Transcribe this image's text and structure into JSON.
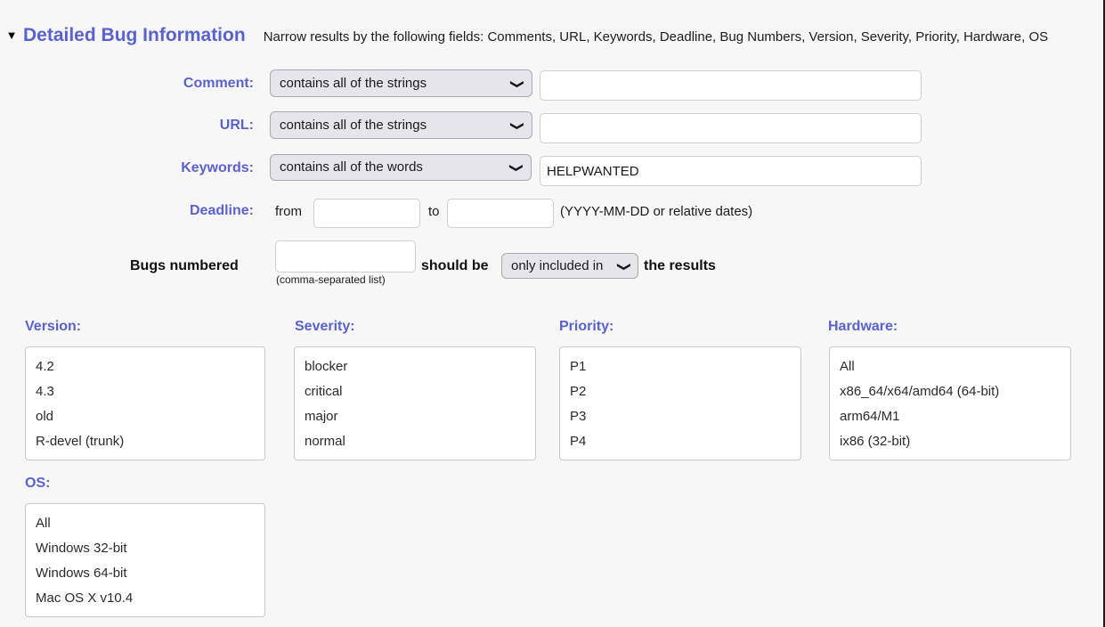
{
  "section": {
    "twisty": "▼",
    "title": "Detailed Bug Information",
    "description": "Narrow results by the following fields: Comments, URL, Keywords, Deadline, Bug Numbers, Version, Severity, Priority, Hardware, OS"
  },
  "accent_color": "#5a62cf",
  "rows": {
    "comment": {
      "label": "Comment:",
      "match_type": "contains all of the strings",
      "value": "",
      "placeholder": ""
    },
    "url": {
      "label": "URL:",
      "match_type": "contains all of the strings",
      "value": "",
      "placeholder": ""
    },
    "keywords": {
      "label": "Keywords:",
      "match_type": "contains all of the words",
      "value": "HELPWANTED",
      "placeholder": ""
    },
    "deadline": {
      "label": "Deadline:",
      "from_label": "from",
      "from_value": "",
      "to_label": "to",
      "to_value": "",
      "format_hint": "(YYYY-MM-DD or relative dates)"
    },
    "bugs_numbered": {
      "label": "Bugs numbered",
      "value": "",
      "hint": "(comma-separated list)",
      "should_be_label": "should be",
      "inclusion": "only included in",
      "results_label": "the results"
    }
  },
  "lists": [
    {
      "key": "version",
      "label": "Version:",
      "options": [
        "4.2",
        "4.3",
        "old",
        "R-devel (trunk)"
      ]
    },
    {
      "key": "severity",
      "label": "Severity:",
      "options": [
        "blocker",
        "critical",
        "major",
        "normal"
      ]
    },
    {
      "key": "priority",
      "label": "Priority:",
      "options": [
        "P1",
        "P2",
        "P3",
        "P4"
      ]
    },
    {
      "key": "hardware",
      "label": "Hardware:",
      "options": [
        "All",
        "x86_64/x64/amd64 (64-bit)",
        "arm64/M1",
        "ix86 (32-bit)"
      ]
    },
    {
      "key": "os",
      "label": "OS:",
      "options": [
        "All",
        "Windows 32-bit",
        "Windows 64-bit",
        "Mac OS X v10.4"
      ]
    }
  ]
}
